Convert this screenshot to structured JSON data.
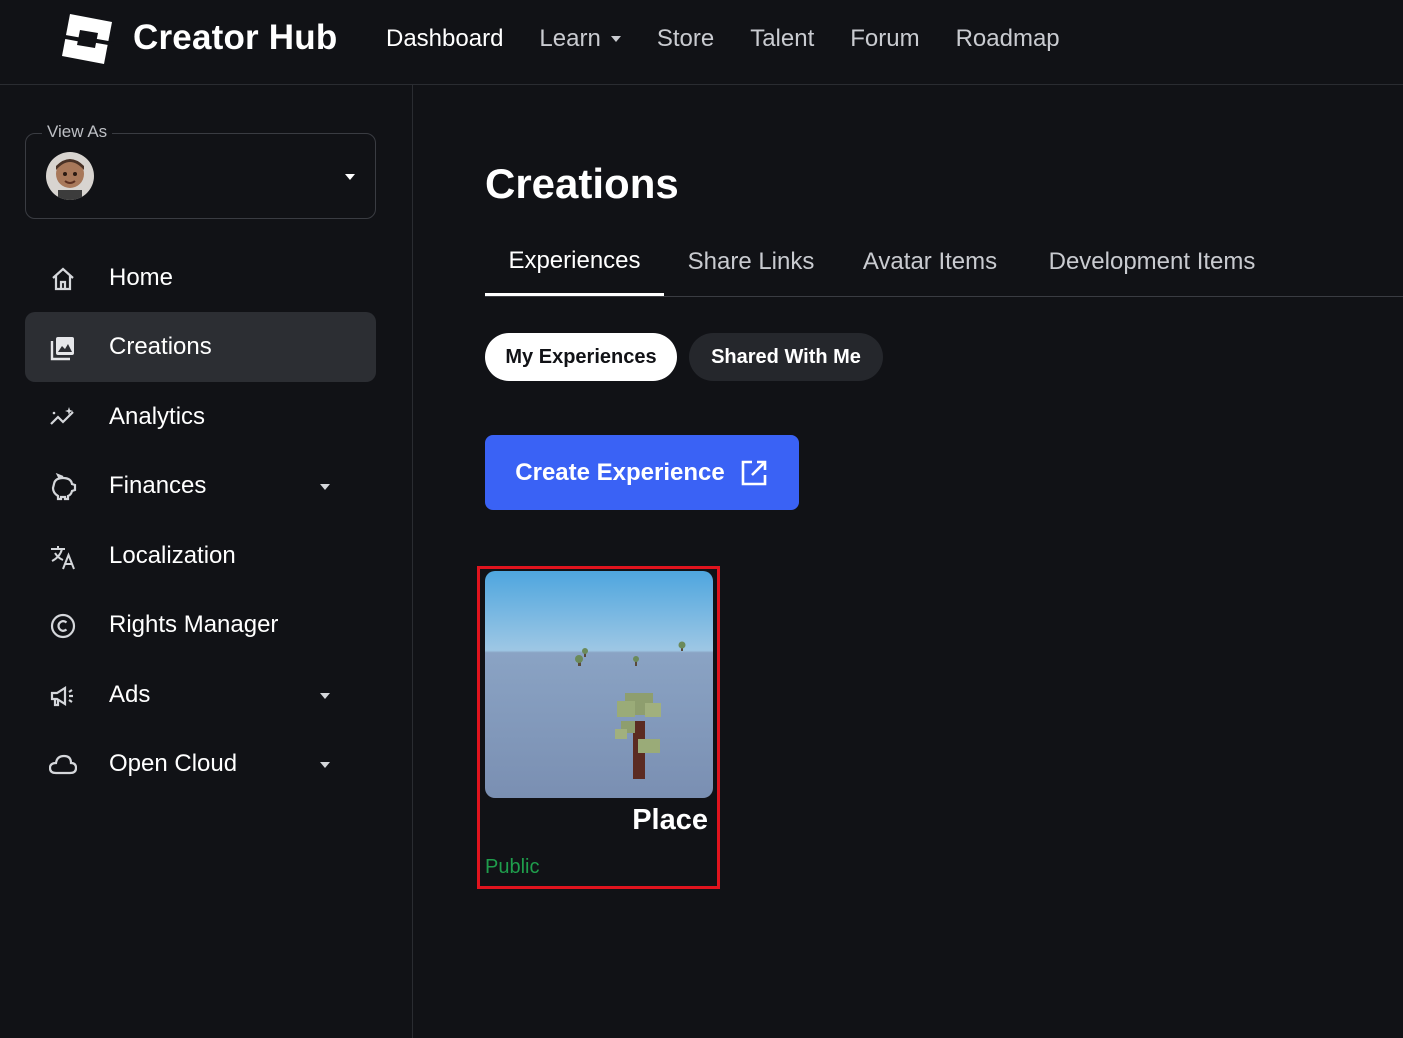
{
  "header": {
    "brand": "Creator Hub",
    "nav": [
      {
        "label": "Dashboard",
        "active": true
      },
      {
        "label": "Learn",
        "has_dropdown": true
      },
      {
        "label": "Store"
      },
      {
        "label": "Talent"
      },
      {
        "label": "Forum"
      },
      {
        "label": "Roadmap"
      }
    ]
  },
  "sidebar": {
    "view_as_label": "View As",
    "items": [
      {
        "label": "Home",
        "icon": "home-icon"
      },
      {
        "label": "Creations",
        "icon": "image-gallery-icon",
        "active": true
      },
      {
        "label": "Analytics",
        "icon": "analytics-icon"
      },
      {
        "label": "Finances",
        "icon": "piggy-bank-icon",
        "has_dropdown": true
      },
      {
        "label": "Localization",
        "icon": "translate-icon"
      },
      {
        "label": "Rights Manager",
        "icon": "copyright-icon"
      },
      {
        "label": "Ads",
        "icon": "megaphone-icon",
        "has_dropdown": true
      },
      {
        "label": "Open Cloud",
        "icon": "cloud-icon",
        "has_dropdown": true
      }
    ]
  },
  "main": {
    "title": "Creations",
    "tabs": [
      {
        "label": "Experiences",
        "active": true
      },
      {
        "label": "Share Links"
      },
      {
        "label": "Avatar Items"
      },
      {
        "label": "Development Items"
      }
    ],
    "filters": [
      {
        "label": "My Experiences",
        "active": true
      },
      {
        "label": "Shared With Me"
      }
    ],
    "create_button": "Create Experience",
    "experiences": [
      {
        "name": "Place",
        "status": "Public"
      }
    ]
  },
  "colors": {
    "background": "#111216",
    "accent": "#3a62f5",
    "status_public": "#1f9d4c",
    "highlight_frame": "#e0141e"
  }
}
